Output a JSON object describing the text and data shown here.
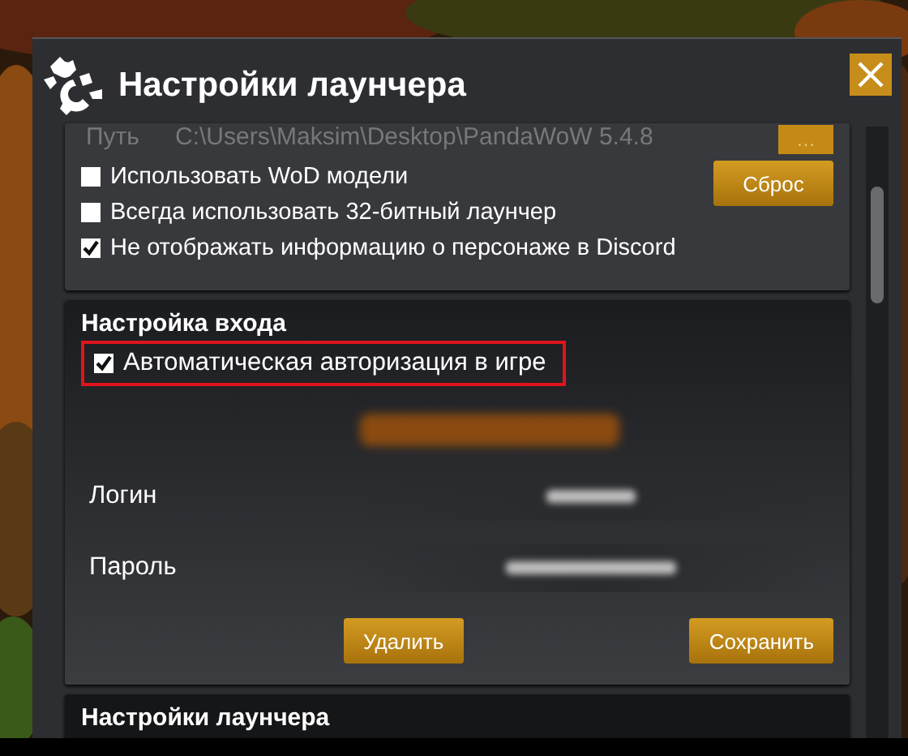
{
  "window": {
    "title": "Настройки лаунчера"
  },
  "game_panel": {
    "path_label": "Путь",
    "path_value": "C:\\Users\\Maksim\\Desktop\\PandaWoW 5.4.8",
    "browse_button": "…",
    "reset_button": "Сброс",
    "options": [
      {
        "label": "Использовать WoD модели",
        "checked": false
      },
      {
        "label": "Всегда использовать 32-битный лаунчер",
        "checked": false
      },
      {
        "label": "Не отображать информацию о персонаже в Discord",
        "checked": true
      }
    ]
  },
  "login_panel": {
    "title": "Настройка входа",
    "auto_login": {
      "label": "Автоматическая авторизация в игре",
      "checked": true,
      "highlighted": true
    },
    "fields": [
      {
        "label": "Логин"
      },
      {
        "label": "Пароль"
      }
    ],
    "buttons": [
      "Удалить",
      "Сохранить"
    ]
  },
  "launcher_panel": {
    "title": "Настройки лаунчера"
  }
}
